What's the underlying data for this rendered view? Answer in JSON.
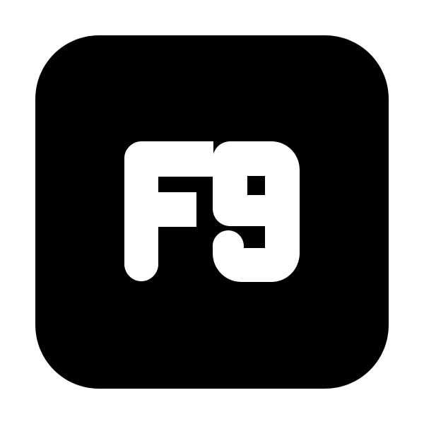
{
  "icon": {
    "name": "f9-key-icon",
    "glyph_text": "F9",
    "colors": {
      "background": "#ffffff",
      "key": "#000000",
      "glyph": "#ffffff"
    }
  }
}
